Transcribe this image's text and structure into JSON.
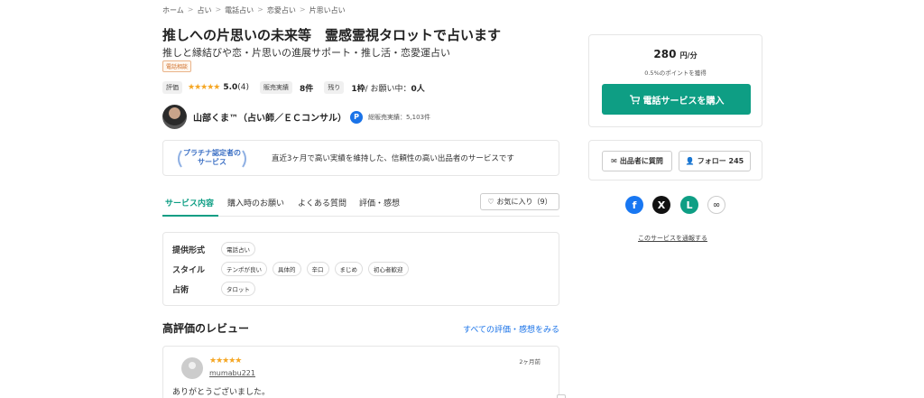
{
  "breadcrumb": [
    "ホーム",
    "占い",
    "電話占い",
    "恋愛占い",
    "片思い占い"
  ],
  "title": "推しへの片思いの未来等　霊感霊視タロットで占います",
  "subtitle": "推しと縁結びや恋・片思いの進展サポート・推し活・恋愛運占い",
  "tag": "電話相談",
  "stats": {
    "rating_chip": "評価",
    "stars": "★★★★★",
    "rating": "5.0",
    "rating_count": "(4)",
    "sales_chip": "販売実績",
    "sales": "8件",
    "remaining_chip": "残り",
    "remaining_num": "1枠",
    "waiting_label": " / お願い中：",
    "waiting_num": "0人"
  },
  "seller": {
    "name": "山部くま™（占い師／ＥＣコンサル）",
    "badge": "P",
    "total_sales": "総販売実績：5,103件"
  },
  "platinum": {
    "badge": "プラチナ認定者の\nサービス",
    "description": "直近3ヶ月で高い実績を維持した、信頼性の高い出品者のサービスです"
  },
  "tabs": [
    "サービス内容",
    "購入時のお願い",
    "よくある質問",
    "評価・感想"
  ],
  "favorite": "お気に入り（9）",
  "details": [
    {
      "label": "提供形式",
      "tags": [
        "電話占い"
      ]
    },
    {
      "label": "スタイル",
      "tags": [
        "テンポが良い",
        "具体的",
        "辛口",
        "まじめ",
        "初心者歓迎"
      ]
    },
    {
      "label": "占術",
      "tags": [
        "タロット"
      ]
    }
  ],
  "reviews": {
    "title": "高評価のレビュー",
    "see_all": "すべての評価・感想をみる",
    "items": [
      {
        "stars": "★★★★★",
        "user": "mumabu221",
        "time": "2ヶ月前",
        "text": "ありがとうございました。"
      }
    ]
  },
  "price": {
    "amount": "280",
    "unit": "円/分",
    "points": "0.5%のポイントを獲得",
    "buy_label": "電話サービスを購入"
  },
  "actions": {
    "ask_label": "出品者に質問",
    "follow_label": "フォロー 245"
  },
  "social": {
    "facebook": "f",
    "x": "X",
    "line": "L",
    "link": "∞"
  },
  "report": "このサービスを通報する",
  "colors": {
    "brand": "#0e9e84",
    "link": "#1a73e8",
    "star": "#f5a623",
    "facebook": "#1877f2",
    "x": "#111111",
    "line": "#0e9e84"
  }
}
